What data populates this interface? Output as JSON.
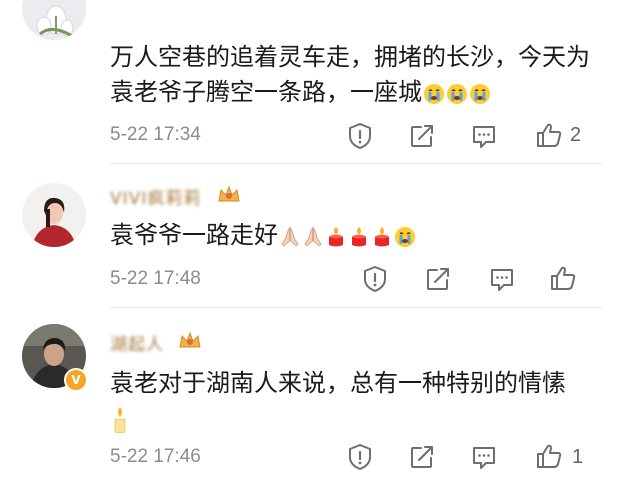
{
  "comments": [
    {
      "username": "",
      "content": "万人空巷的追着灵车走，拥堵的长沙，今天为袁老爷子腾空一条路，一座城",
      "emojis": [
        "crying-emoji",
        "crying-emoji",
        "crying-emoji"
      ],
      "timestamp": "5-22 17:34",
      "likes": "2"
    },
    {
      "username": "VIVI疯莉莉",
      "content": "袁爷爷一路走好",
      "emojis": [
        "praying-hands-emoji",
        "praying-hands-emoji",
        "candle-emoji",
        "candle-emoji",
        "candle-emoji",
        "crying-emoji"
      ],
      "timestamp": "5-22 17:48",
      "likes": ""
    },
    {
      "username": "湖起人",
      "content": "袁老对于湖南人来说，总有一种特别的情愫",
      "emojis": [
        "candle-emoji"
      ],
      "timestamp": "5-22 17:46",
      "likes": "1"
    }
  ],
  "colors": {
    "username": "#a57a3c",
    "timestamp": "#8c8c8c",
    "icon": "#6e6e6e",
    "verified_badge": "#f5a623"
  }
}
